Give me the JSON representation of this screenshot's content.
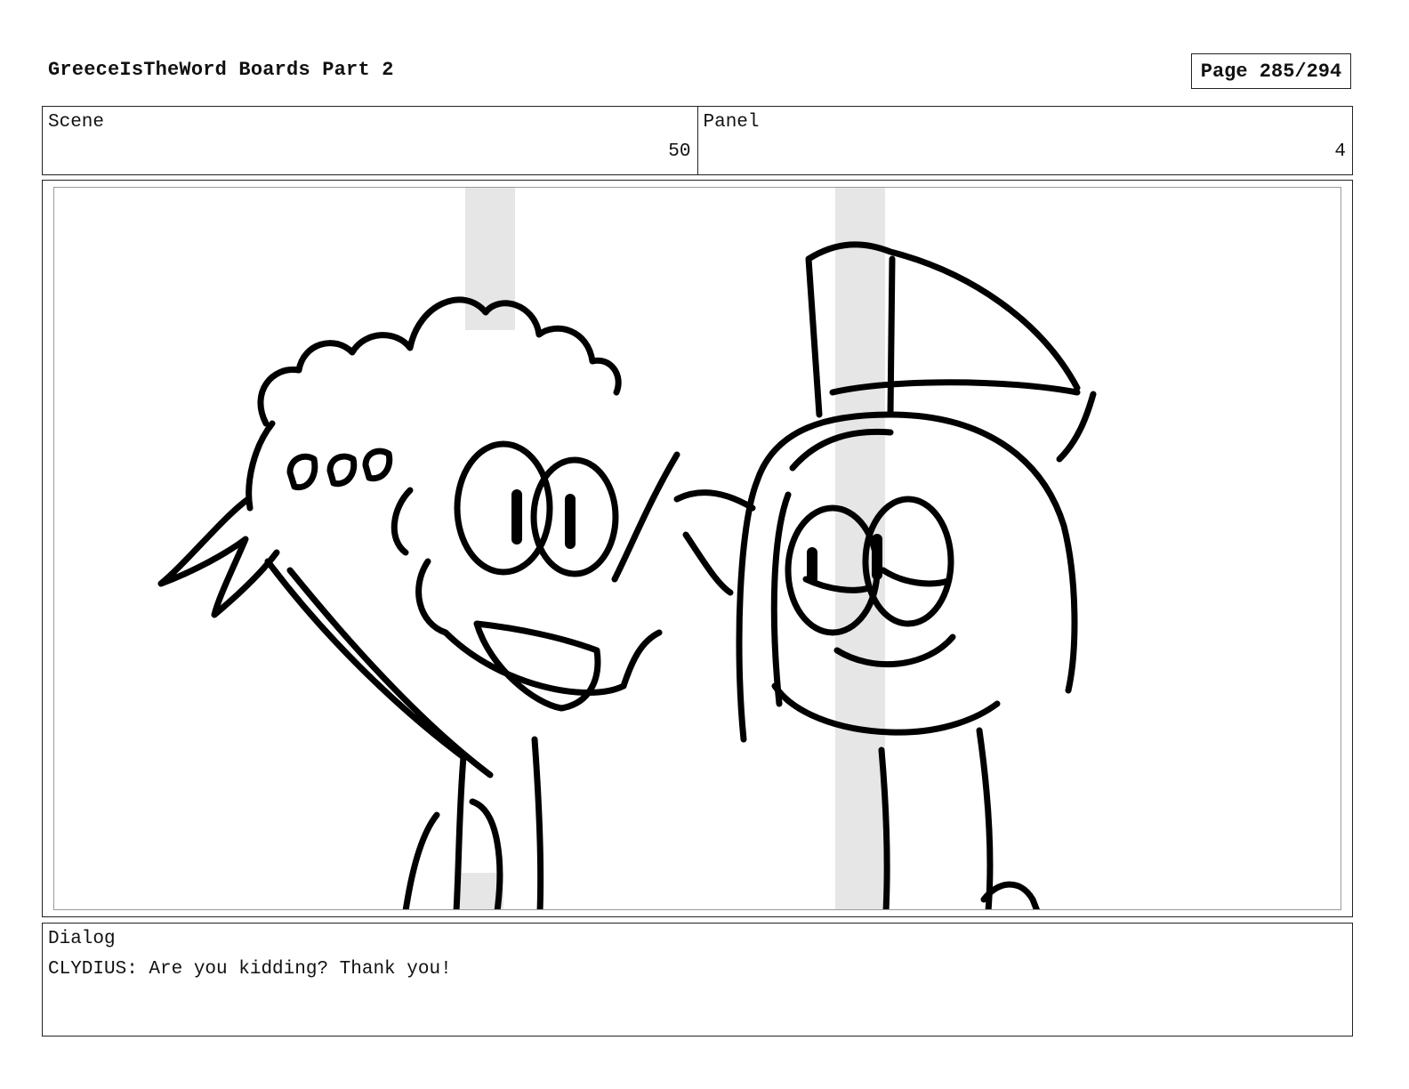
{
  "document": {
    "title": "GreeceIsTheWord Boards Part 2",
    "page_label": "Page 285/294"
  },
  "info": {
    "scene_label": "Scene",
    "scene_value": "50",
    "panel_label": "Panel",
    "panel_value": "4"
  },
  "panel_image": {
    "description_icon": "storyboard-sketch",
    "stroke_color": "#000000",
    "guide_color": "#e6e6e6"
  },
  "dialog": {
    "label": "Dialog",
    "text": "CLYDIUS: Are you kidding? Thank you!"
  }
}
